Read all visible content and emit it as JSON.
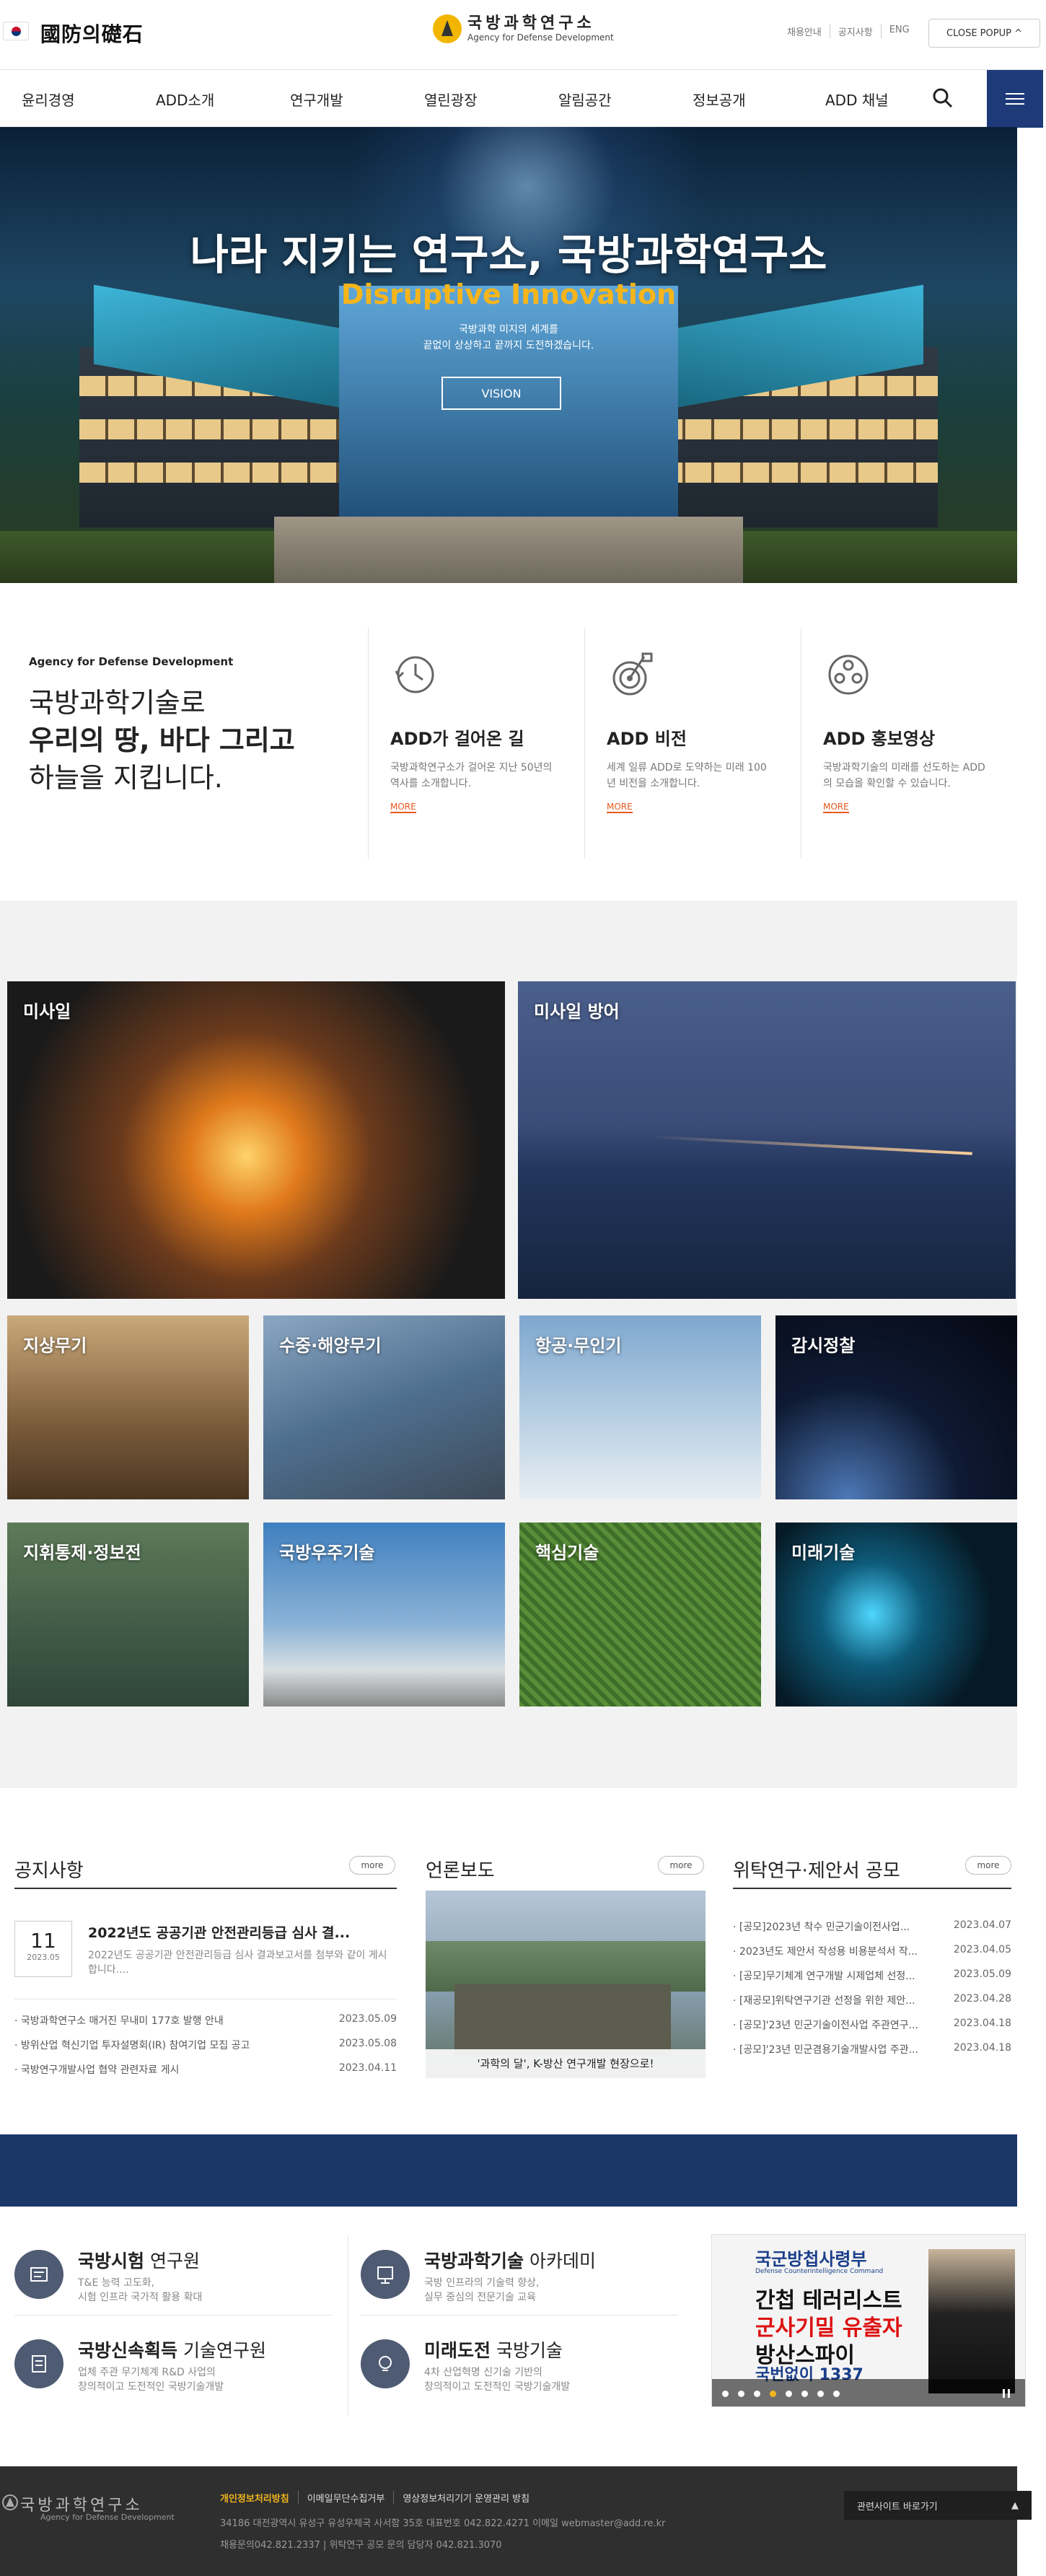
{
  "header": {
    "left_logo": "國防의礎石",
    "brand_ko": "국방과학연구소",
    "brand_en": "Agency for Defense Development",
    "utils": [
      "채용안내",
      "공지사항",
      "ENG"
    ],
    "close_popup": "CLOSE POPUP ^"
  },
  "gnb": {
    "items": [
      "윤리경영",
      "ADD소개",
      "연구개발",
      "열린광장",
      "알림공간",
      "정보공개",
      "ADD 채널"
    ]
  },
  "hero": {
    "title": "나라 지키는 연구소, 국방과학연구소",
    "subtitle": "Disruptive Innovation",
    "desc1": "국방과학 미지의 세계를",
    "desc2": "끝없이 상상하고 끝까지 도전하겠습니다.",
    "button": "VISION"
  },
  "about": {
    "small": "Agency for Defense Development",
    "head1": "국방과학기술로",
    "head2": "우리의 땅, 바다 그리고",
    "head3": "하늘을 지킵니다.",
    "cards": [
      {
        "title": "ADD가 걸어온 길",
        "desc": "국방과학연구소가 걸어온 지난 50년의 역사를 소개합니다.",
        "more": "MORE",
        "icon": "history-clock-icon"
      },
      {
        "title": "ADD 비전",
        "desc": "세계 일류 ADD로 도약하는 미래 100년 비전을 소개합니다.",
        "more": "MORE",
        "icon": "target-flag-icon"
      },
      {
        "title": "ADD 홍보영상",
        "desc": "국방과학기술의 미래를 선도하는 ADD의 모습을 확인할 수 있습니다.",
        "more": "MORE",
        "icon": "film-reel-icon"
      }
    ]
  },
  "tech": {
    "big": [
      "미사일",
      "미사일 방어"
    ],
    "small_row1": [
      "지상무기",
      "수중·해양무기",
      "항공·무인기",
      "감시정찰"
    ],
    "small_row2": [
      "지휘통제·정보전",
      "국방우주기술",
      "핵심기술",
      "미래기술"
    ]
  },
  "notices": {
    "title": "공지사항",
    "more": "more",
    "featured": {
      "day": "11",
      "ym": "2023.05",
      "title": "2022년도 공공기관 안전관리등급 심사 결...",
      "desc": "2022년도 공공기관 안전관리등급 심사 결과보고서를 첨부와 같이 게시합니다...."
    },
    "items": [
      {
        "title": "국방과학연구소 매거진 무내미 177호 발행 안내",
        "date": "2023.05.09"
      },
      {
        "title": "방위산업 혁신기업 투자설명회(IR) 참여기업 모집 공고",
        "date": "2023.05.08"
      },
      {
        "title": "국방연구개발사업 협약 관련자료 게시",
        "date": "2023.04.11"
      }
    ]
  },
  "press": {
    "title": "언론보도",
    "more": "more",
    "caption": "'과학의 달', K-방산 연구개발 현장으로!"
  },
  "contract": {
    "title": "위탁연구·제안서 공모",
    "more": "more",
    "items": [
      {
        "title": "[공모]2023년 착수 민군기술이전사업...",
        "date": "2023.04.07"
      },
      {
        "title": "2023년도 제안서 작성용 비용분석서 작...",
        "date": "2023.04.05"
      },
      {
        "title": "[공모]무기체계 연구개발 시제업체 선정...",
        "date": "2023.05.09"
      },
      {
        "title": "[재공모]위탁연구기관 선정을 위한 제안...",
        "date": "2023.04.28"
      },
      {
        "title": "[공모]'23년 민군기술이전사업 주관연구...",
        "date": "2023.04.18"
      },
      {
        "title": "[공모]'23년 민군겸용기술개발사업 주관...",
        "date": "2023.04.18"
      }
    ]
  },
  "services": [
    {
      "bold": "국방시험",
      "rest": " 연구원",
      "desc1": "T&E 능력 고도화,",
      "desc2": "시험 인프라 국가적 활용 확대"
    },
    {
      "bold": "국방과학기술",
      "rest": " 아카데미",
      "desc1": "국방 인프라의 기술력 향상,",
      "desc2": "실무 중심의 전문기술 교육"
    },
    {
      "bold": "국방신속획득",
      "rest": " 기술연구원",
      "desc1": "업체 주관 무기체계 R&D 사업의",
      "desc2": "창의적이고 도전적인 국방기술개발"
    },
    {
      "bold": "미래도전",
      "rest": " 국방기술",
      "desc1": "4차 산업혁명 신기술 기반의",
      "desc2": "창의적이고 도전적인 국방기술개발"
    }
  ],
  "banner": {
    "top": "국군방첩사령부",
    "small": "Defense Counterintelligence Command",
    "line1": "간첩 테러리스트",
    "line2": "군사기밀 유출자",
    "line3": "방산스파이",
    "call": "국번없이 1337"
  },
  "footer": {
    "logo": "국방과학연구소",
    "logo_en": "Agency for Defense Development",
    "links": [
      "개인정보처리방침",
      "이메일무단수집거부",
      "영상정보처리기기 운영관리 방침"
    ],
    "address": "34186 대전광역시 유성구 유성우체국 사서함 35호 대표번호 042.822.4271 이메일 webmaster@add.re.kr",
    "tel": "채용문의042.821.2337  |  위탁연구 공모 문의 담당자 042.821.3070",
    "site_select": "관련사이트 바로가기"
  }
}
